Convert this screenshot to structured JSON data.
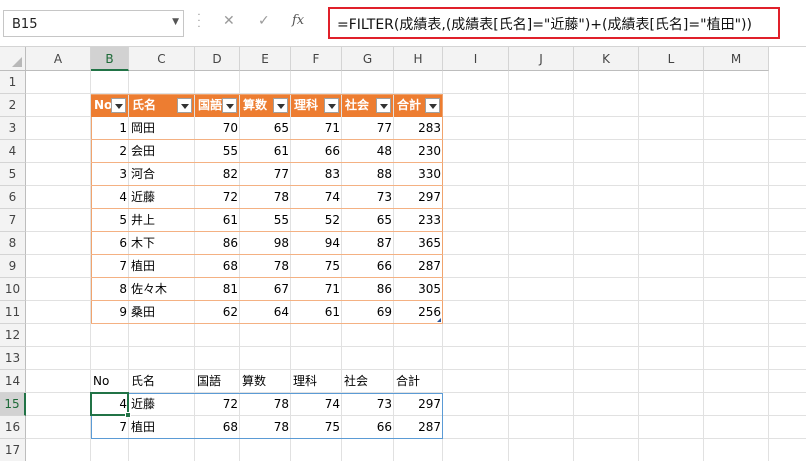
{
  "name_box": {
    "value": "B15"
  },
  "formula_bar": {
    "cancel_icon": "✕",
    "enter_icon": "✓",
    "fx_label": "fx",
    "formula": "=FILTER(成績表,(成績表[氏名]=\"近藤\")+(成績表[氏名]=\"植田\"))"
  },
  "columns": [
    "A",
    "B",
    "C",
    "D",
    "E",
    "F",
    "G",
    "H",
    "I",
    "J",
    "K",
    "L",
    "M"
  ],
  "rows": [
    "1",
    "2",
    "3",
    "4",
    "5",
    "6",
    "7",
    "8",
    "9",
    "10",
    "11",
    "12",
    "13",
    "14",
    "15",
    "16",
    "17"
  ],
  "selected": {
    "column": "B",
    "row": "15"
  },
  "table": {
    "name": "成績表",
    "headers": [
      "No",
      "氏名",
      "国語",
      "算数",
      "理科",
      "社会",
      "合計"
    ],
    "rows": [
      [
        "1",
        "岡田",
        "70",
        "65",
        "71",
        "77",
        "283"
      ],
      [
        "2",
        "会田",
        "55",
        "61",
        "66",
        "48",
        "230"
      ],
      [
        "3",
        "河合",
        "82",
        "77",
        "83",
        "88",
        "330"
      ],
      [
        "4",
        "近藤",
        "72",
        "78",
        "74",
        "73",
        "297"
      ],
      [
        "5",
        "井上",
        "61",
        "55",
        "52",
        "65",
        "233"
      ],
      [
        "6",
        "木下",
        "86",
        "98",
        "94",
        "87",
        "365"
      ],
      [
        "7",
        "植田",
        "68",
        "78",
        "75",
        "66",
        "287"
      ],
      [
        "8",
        "佐々木",
        "81",
        "67",
        "71",
        "86",
        "305"
      ],
      [
        "9",
        "桑田",
        "62",
        "64",
        "61",
        "69",
        "256"
      ]
    ]
  },
  "result": {
    "headers": [
      "No",
      "氏名",
      "国語",
      "算数",
      "理科",
      "社会",
      "合計"
    ],
    "rows": [
      [
        "4",
        "近藤",
        "72",
        "78",
        "74",
        "73",
        "297"
      ],
      [
        "7",
        "植田",
        "68",
        "78",
        "75",
        "66",
        "287"
      ]
    ]
  },
  "colors": {
    "table_header": "#ed7d31",
    "formula_highlight": "#e0202a",
    "selection": "#217346",
    "spill_border": "#5b9bd5"
  }
}
